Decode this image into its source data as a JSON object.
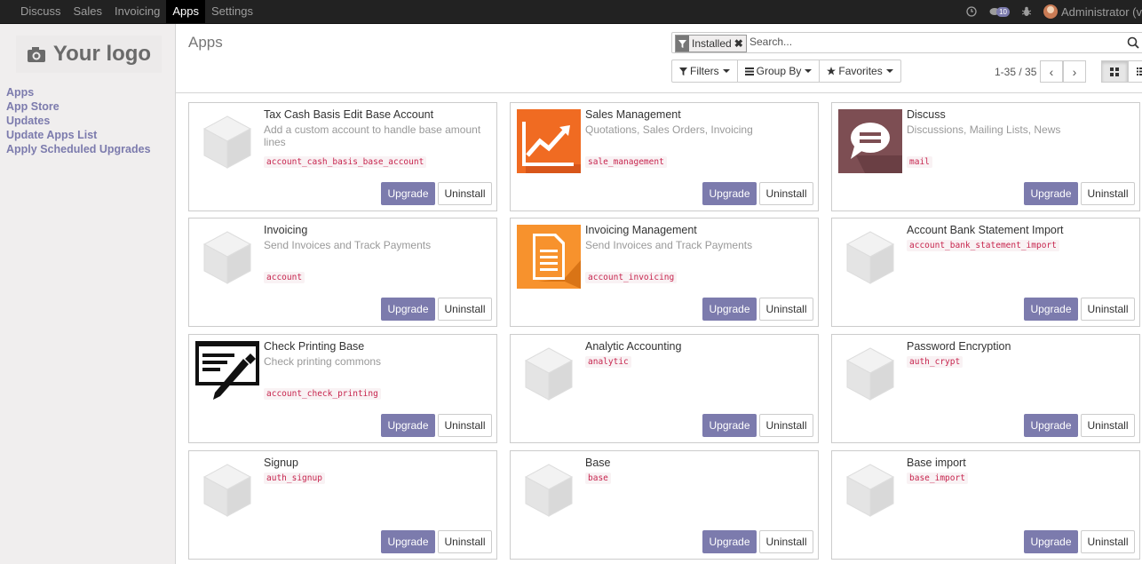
{
  "topbar": {
    "menu": [
      "Discuss",
      "Sales",
      "Invoicing",
      "Apps",
      "Settings"
    ],
    "active": "Apps",
    "notifications_count": "10",
    "user_label": "Administrator (v"
  },
  "sidebar": {
    "logo_text": "Your logo",
    "items": [
      "Apps",
      "App Store",
      "Updates",
      "Update Apps List",
      "Apply Scheduled Upgrades"
    ]
  },
  "control_panel": {
    "title": "Apps",
    "facet_value": "Installed",
    "search_placeholder": "Search...",
    "filters_label": "Filters",
    "groupby_label": "Group By",
    "favorites_label": "Favorites",
    "pager": "1-35 / 35"
  },
  "buttons": {
    "upgrade": "Upgrade",
    "uninstall": "Uninstall"
  },
  "apps": [
    {
      "name": "Tax Cash Basis Edit Base Account",
      "summary": "Add a custom account to handle base amount lines",
      "technical": "account_cash_basis_base_account",
      "icon": "default-cube-icon"
    },
    {
      "name": "Sales Management",
      "summary": "Quotations, Sales Orders, Invoicing",
      "technical": "sale_management",
      "icon": "sales-chart-icon"
    },
    {
      "name": "Discuss",
      "summary": "Discussions, Mailing Lists, News",
      "technical": "mail",
      "icon": "chat-bubble-icon"
    },
    {
      "name": "Invoicing",
      "summary": "Send Invoices and Track Payments",
      "technical": "account",
      "icon": "default-cube-icon"
    },
    {
      "name": "Invoicing Management",
      "summary": "Send Invoices and Track Payments",
      "technical": "account_invoicing",
      "icon": "invoice-document-icon"
    },
    {
      "name": "Account Bank Statement Import",
      "summary": "",
      "technical": "account_bank_statement_import",
      "icon": "default-cube-icon"
    },
    {
      "name": "Check Printing Base",
      "summary": "Check printing commons",
      "technical": "account_check_printing",
      "icon": "check-printing-icon"
    },
    {
      "name": "Analytic Accounting",
      "summary": "",
      "technical": "analytic",
      "icon": "default-cube-icon"
    },
    {
      "name": "Password Encryption",
      "summary": "",
      "technical": "auth_crypt",
      "icon": "default-cube-icon"
    },
    {
      "name": "Signup",
      "summary": "",
      "technical": "auth_signup",
      "icon": "default-cube-icon"
    },
    {
      "name": "Base",
      "summary": "",
      "technical": "base",
      "icon": "default-cube-icon"
    },
    {
      "name": "Base import",
      "summary": "",
      "technical": "base_import",
      "icon": "default-cube-icon"
    }
  ]
}
